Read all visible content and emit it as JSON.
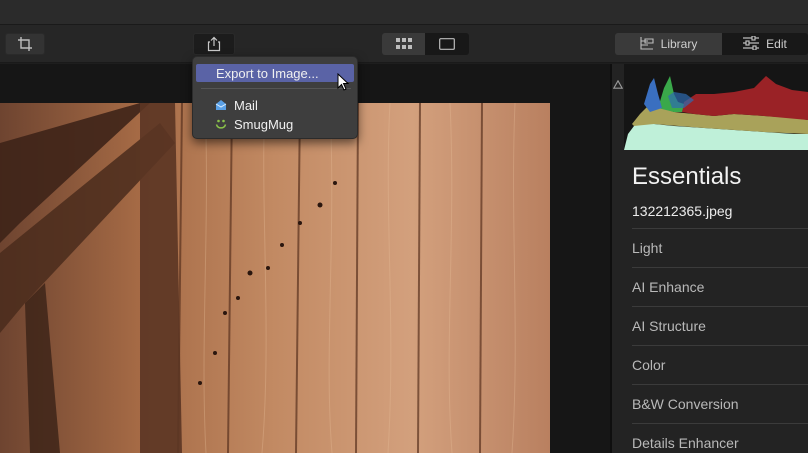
{
  "toolbar": {
    "crop_icon": "crop-icon",
    "share_icon": "share-icon",
    "grid_view_icon": "grid-view-icon",
    "single_view_icon": "single-view-icon",
    "library_label": "Library",
    "library_icon": "library-icon",
    "edit_label": "Edit",
    "edit_icon": "sliders-icon"
  },
  "share_menu": {
    "items": [
      {
        "label": "Export to Image...",
        "highlighted": true
      },
      {
        "label": "Mail",
        "icon": "mail-icon"
      },
      {
        "label": "SmugMug",
        "icon": "smugmug-icon"
      }
    ],
    "highlight_color": "#5a63a6"
  },
  "panel": {
    "section_title": "Essentials",
    "filename": "132212365.jpeg",
    "tools": [
      {
        "label": "Light"
      },
      {
        "label": "AI Enhance"
      },
      {
        "label": "AI Structure"
      },
      {
        "label": "Color"
      },
      {
        "label": "B&W Conversion"
      },
      {
        "label": "Details Enhancer"
      }
    ],
    "histogram_colors": {
      "blue": "#3a6fc0",
      "green": "#3aa84a",
      "red": "#9a2226",
      "yellow": "#a9a25a",
      "cyan": "#bff0d9"
    }
  }
}
